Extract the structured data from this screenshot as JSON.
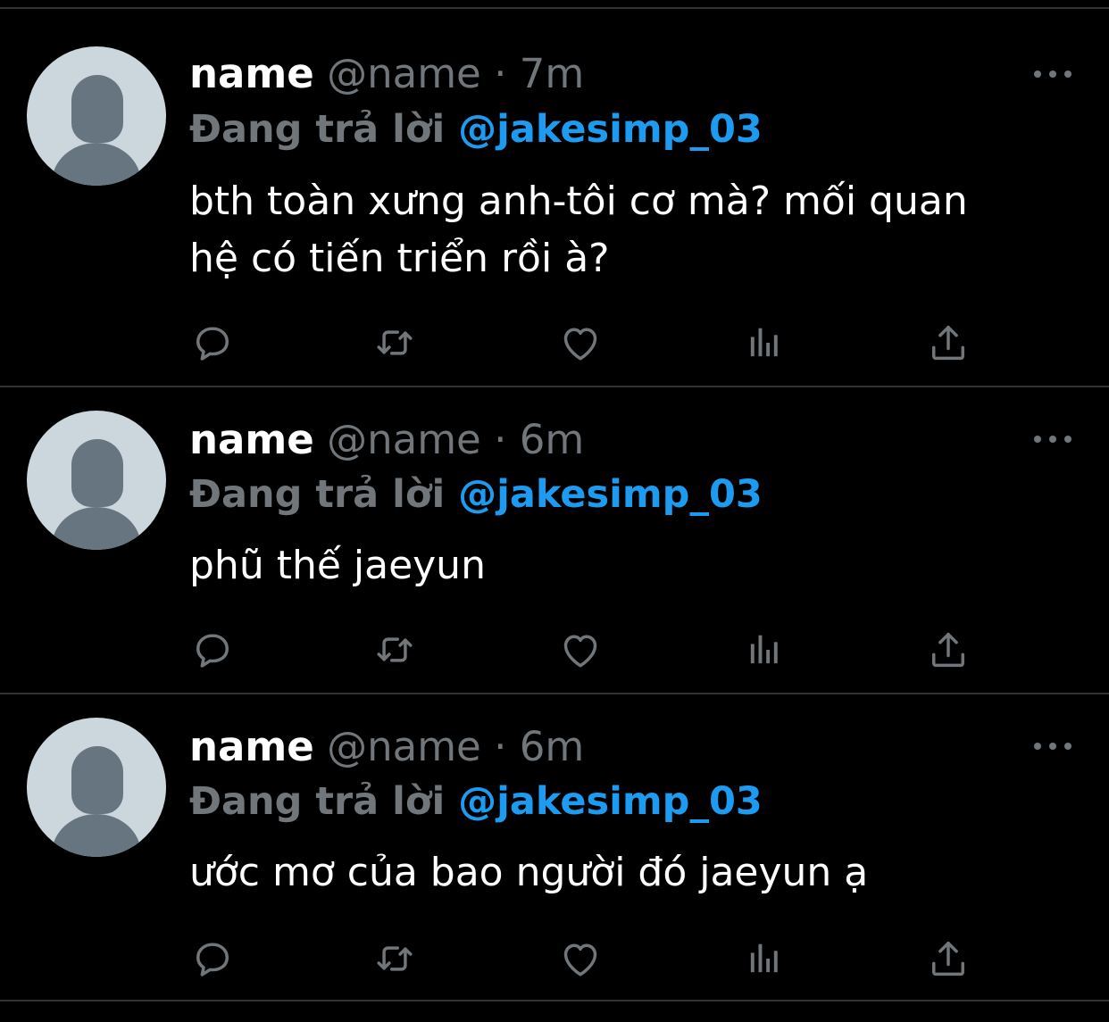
{
  "tweets": [
    {
      "display_name": "name",
      "handle": "@name",
      "separator": "·",
      "time": "7m",
      "reply_prefix": "Đang trả lời",
      "reply_handle": "@jakesimp_03",
      "text": "bth toàn xưng anh-tôi cơ mà? mối quan hệ có tiến triển rồi à?"
    },
    {
      "display_name": "name",
      "handle": "@name",
      "separator": "·",
      "time": "6m",
      "reply_prefix": "Đang trả lời",
      "reply_handle": "@jakesimp_03",
      "text": "phũ thế jaeyun"
    },
    {
      "display_name": "name",
      "handle": "@name",
      "separator": "·",
      "time": "6m",
      "reply_prefix": "Đang trả lời",
      "reply_handle": "@jakesimp_03",
      "text": "ước mơ của bao người đó jaeyun ạ"
    }
  ],
  "icons": {
    "reply": "comment-icon",
    "retweet": "retweet-icon",
    "like": "heart-icon",
    "views": "analytics-icon",
    "share": "share-icon",
    "more": "more-icon",
    "avatar": "default-avatar-icon"
  },
  "colors": {
    "background": "#000000",
    "primary_text": "#ffffff",
    "secondary_text": "#71767b",
    "accent": "#1d9bf0",
    "divider": "#2f3336",
    "avatar_bg": "#ccd6dd",
    "avatar_fg": "#66757f"
  }
}
